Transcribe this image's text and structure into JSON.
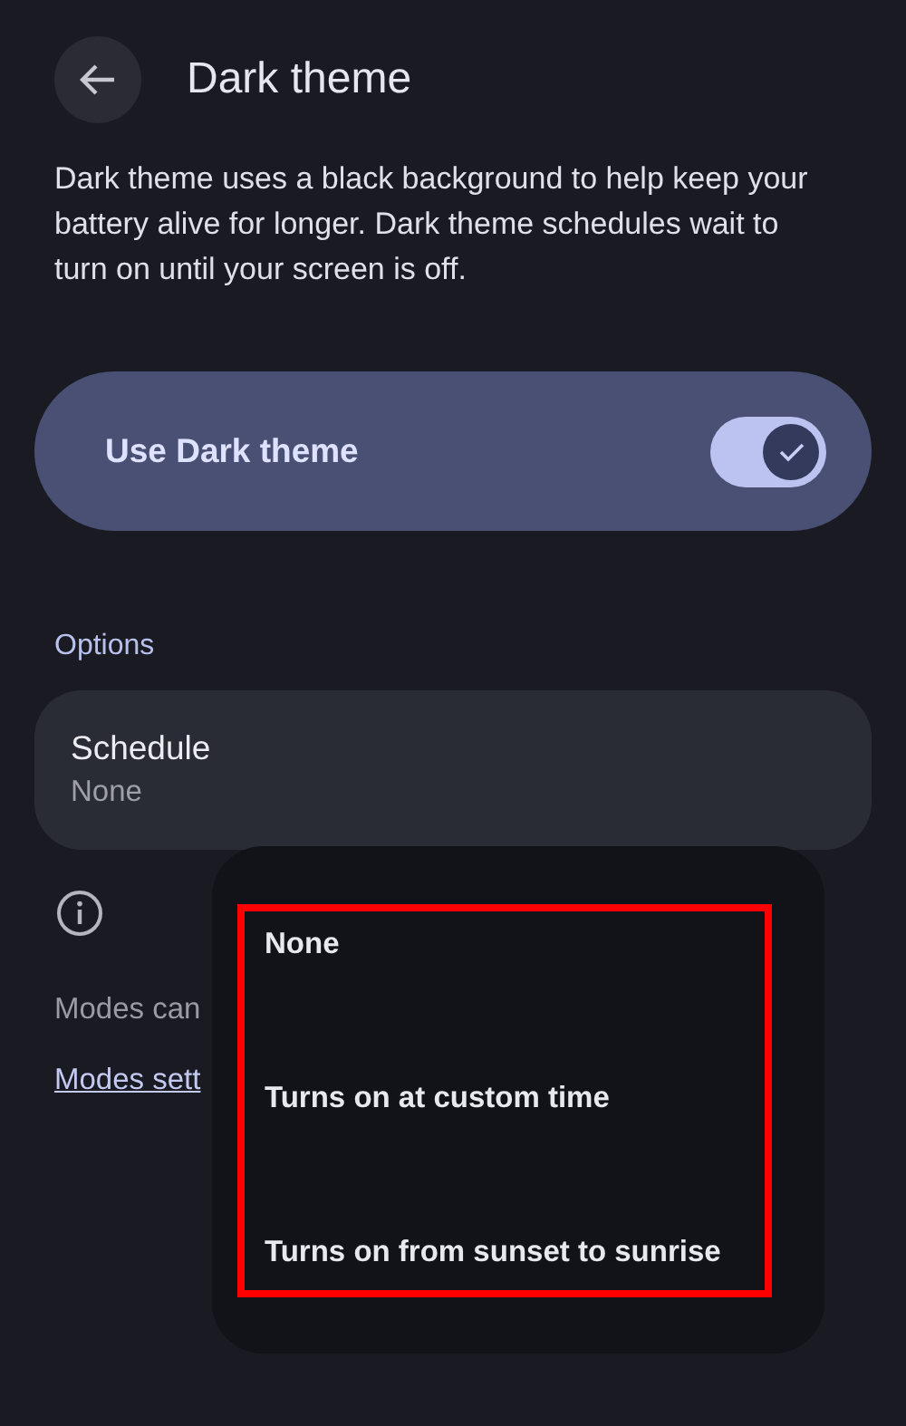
{
  "header": {
    "title": "Dark theme"
  },
  "description": "Dark theme uses a black background to help keep your battery alive for longer. Dark theme schedules wait to turn on until your screen is off.",
  "main_toggle": {
    "label": "Use Dark theme",
    "on": true
  },
  "section_title": "Options",
  "schedule": {
    "title": "Schedule",
    "value": "None"
  },
  "info_text": "Modes can",
  "link": "Modes sett",
  "menu": {
    "highlighted": true,
    "items": [
      {
        "label": "None"
      },
      {
        "label": "Turns on at custom time"
      },
      {
        "label": "Turns on from sunset to sunrise"
      }
    ]
  }
}
